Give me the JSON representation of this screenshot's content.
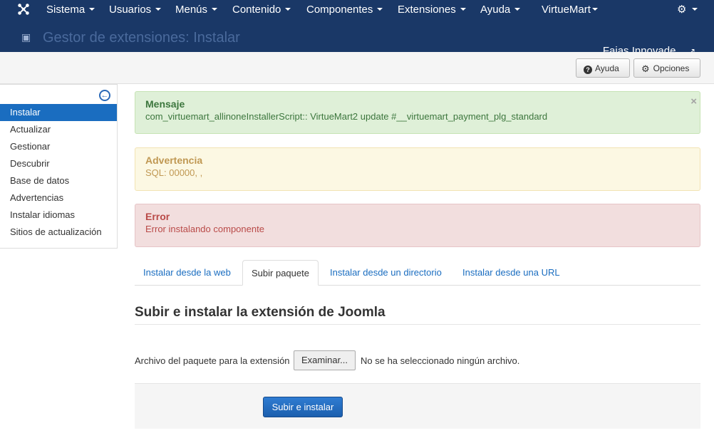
{
  "navbar": {
    "menus": [
      {
        "label": "Sistema"
      },
      {
        "label": "Usuarios"
      },
      {
        "label": "Menús"
      },
      {
        "label": "Contenido"
      },
      {
        "label": "Componentes"
      },
      {
        "label": "Extensiones"
      },
      {
        "label": "Ayuda"
      },
      {
        "label": "VirtueMart"
      }
    ],
    "site_name": "Fajas Innovade..."
  },
  "subheader": {
    "title": "Gestor de extensiones: Instalar"
  },
  "toolbar": {
    "help_label": "Ayuda",
    "options_label": "Opciones"
  },
  "sidebar": {
    "items": [
      {
        "label": "Instalar",
        "active": true
      },
      {
        "label": "Actualizar"
      },
      {
        "label": "Gestionar"
      },
      {
        "label": "Descubrir"
      },
      {
        "label": "Base de datos"
      },
      {
        "label": "Advertencias"
      },
      {
        "label": "Instalar idiomas"
      },
      {
        "label": "Sitios de actualización"
      }
    ]
  },
  "alerts": {
    "message": {
      "heading": "Mensaje",
      "text": "com_virtuemart_allinoneInstallerScript:: VirtueMart2 update #__virtuemart_payment_plg_standard",
      "close": "×"
    },
    "warning": {
      "heading": "Advertencia",
      "text": "SQL: 00000, ,"
    },
    "error": {
      "heading": "Error",
      "text": "Error instalando componente"
    }
  },
  "tabs": [
    {
      "label": "Instalar desde la web"
    },
    {
      "label": "Subir paquete",
      "active": true
    },
    {
      "label": "Instalar desde un directorio"
    },
    {
      "label": "Instalar desde una URL"
    }
  ],
  "upload": {
    "title": "Subir e instalar la extensión de Joomla",
    "file_label": "Archivo del paquete para la extensión",
    "browse_label": "Examinar...",
    "no_file": "No se ha seleccionado ningún archivo.",
    "submit_label": "Subir e instalar"
  },
  "colors": {
    "navbar": "#1a3867",
    "accent": "#1a6dc0",
    "success_bg": "#dff0d8",
    "warning_bg": "#fcf8e3",
    "error_bg": "#f2dede"
  }
}
